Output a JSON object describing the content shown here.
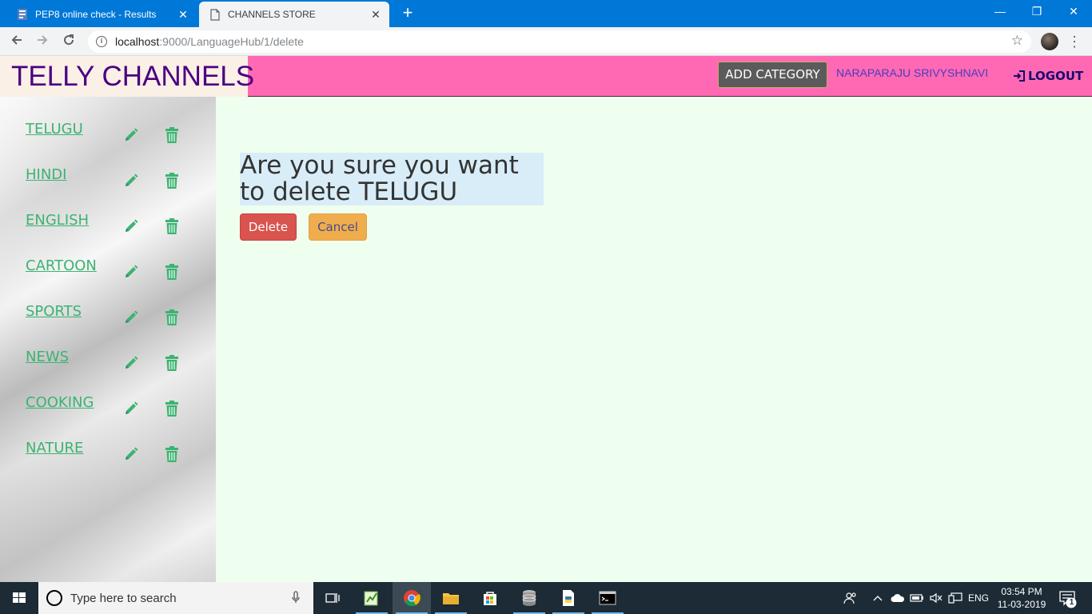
{
  "browser": {
    "tabs": [
      {
        "title": "PEP8 online check - Results",
        "active": false
      },
      {
        "title": "CHANNELS STORE",
        "active": true
      }
    ],
    "url_host": "localhost",
    "url_path": ":9000/LanguageHub/1/delete"
  },
  "header": {
    "brand": "TELLY CHANNELS",
    "add_category": "ADD CATEGORY",
    "user": "NARAPARAJU SRIVYSHNAVI",
    "logout": "LOGOUT"
  },
  "sidebar": {
    "categories": [
      {
        "label": "TELUGU"
      },
      {
        "label": "HINDI"
      },
      {
        "label": "ENGLISH"
      },
      {
        "label": "CARTOON"
      },
      {
        "label": "SPORTS"
      },
      {
        "label": "NEWS"
      },
      {
        "label": "COOKING"
      },
      {
        "label": "NATURE"
      }
    ]
  },
  "main": {
    "confirm_text": "Are you sure you want to delete TELUGU",
    "delete_label": "Delete",
    "cancel_label": "Cancel"
  },
  "colors": {
    "header_bg": "#ff69b4",
    "brand_bg": "#faf0e6",
    "brand_text": "#4b0082",
    "page_bg": "#efffef",
    "link_green": "#3cb371",
    "delete_btn": "#d9534f",
    "cancel_btn": "#f0ad4e",
    "confirm_bg": "#d8edf7"
  },
  "taskbar": {
    "search_placeholder": "Type here to search",
    "language": "ENG",
    "time": "03:54 PM",
    "date": "11-03-2019",
    "notification_count": "1"
  }
}
